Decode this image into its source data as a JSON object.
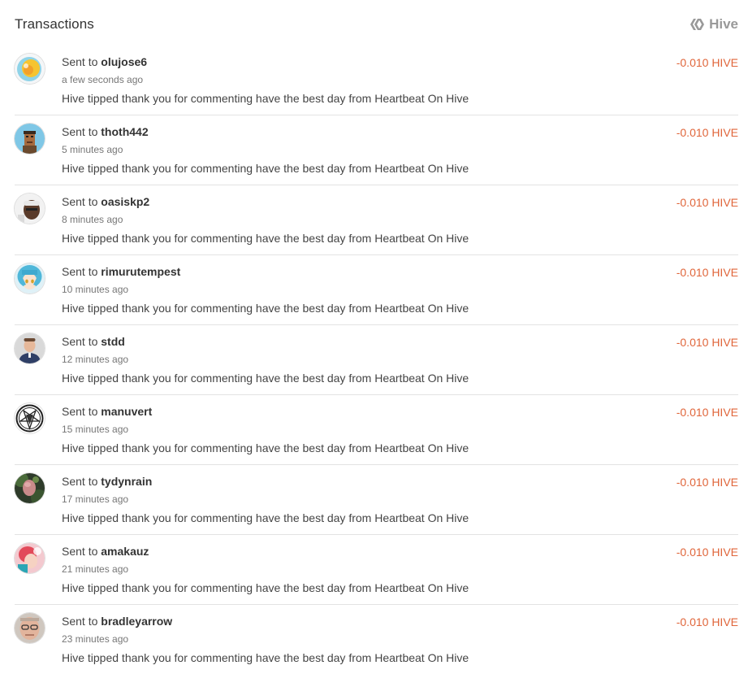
{
  "header": {
    "title": "Transactions",
    "brand_label": "Hive",
    "brand_icon": "hive-logo-icon"
  },
  "colors": {
    "amount": "#e0653a",
    "text": "#333333",
    "muted": "#777777",
    "divider": "#e3e3e3"
  },
  "transactions": [
    {
      "prefix": "Sent to",
      "user": "olujose6",
      "time": "a few seconds ago",
      "memo": "Hive tipped thank you for commenting have the best day from Heartbeat On Hive",
      "amount": "-0.010 HIVE"
    },
    {
      "prefix": "Sent to",
      "user": "thoth442",
      "time": "5 minutes ago",
      "memo": "Hive tipped thank you for commenting have the best day from Heartbeat On Hive",
      "amount": "-0.010 HIVE"
    },
    {
      "prefix": "Sent to",
      "user": "oasiskp2",
      "time": "8 minutes ago",
      "memo": "Hive tipped thank you for commenting have the best day from Heartbeat On Hive",
      "amount": "-0.010 HIVE"
    },
    {
      "prefix": "Sent to",
      "user": "rimurutempest",
      "time": "10 minutes ago",
      "memo": "Hive tipped thank you for commenting have the best day from Heartbeat On Hive",
      "amount": "-0.010 HIVE"
    },
    {
      "prefix": "Sent to",
      "user": "stdd",
      "time": "12 minutes ago",
      "memo": "Hive tipped thank you for commenting have the best day from Heartbeat On Hive",
      "amount": "-0.010 HIVE"
    },
    {
      "prefix": "Sent to",
      "user": "manuvert",
      "time": "15 minutes ago",
      "memo": "Hive tipped thank you for commenting have the best day from Heartbeat On Hive",
      "amount": "-0.010 HIVE"
    },
    {
      "prefix": "Sent to",
      "user": "tydynrain",
      "time": "17 minutes ago",
      "memo": "Hive tipped thank you for commenting have the best day from Heartbeat On Hive",
      "amount": "-0.010 HIVE"
    },
    {
      "prefix": "Sent to",
      "user": "amakauz",
      "time": "21 minutes ago",
      "memo": "Hive tipped thank you for commenting have the best day from Heartbeat On Hive",
      "amount": "-0.010 HIVE"
    },
    {
      "prefix": "Sent to",
      "user": "bradleyarrow",
      "time": "23 minutes ago",
      "memo": "Hive tipped thank you for commenting have the best day from Heartbeat On Hive",
      "amount": "-0.010 HIVE"
    }
  ]
}
